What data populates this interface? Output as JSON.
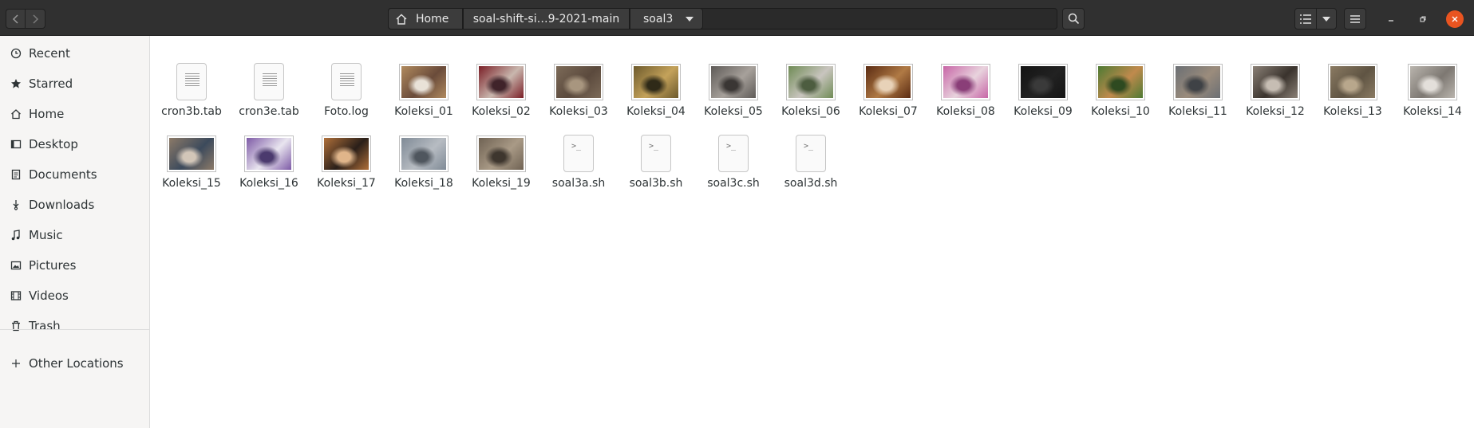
{
  "header": {
    "path": [
      "Home",
      "soal-shift-si…9-2021-main",
      "soal3"
    ]
  },
  "sidebar": {
    "items": [
      {
        "label": "Recent",
        "icon": "clock-icon"
      },
      {
        "label": "Starred",
        "icon": "star-icon"
      },
      {
        "label": "Home",
        "icon": "home-icon"
      },
      {
        "label": "Desktop",
        "icon": "desktop-icon"
      },
      {
        "label": "Documents",
        "icon": "document-icon"
      },
      {
        "label": "Downloads",
        "icon": "download-icon"
      },
      {
        "label": "Music",
        "icon": "music-icon"
      },
      {
        "label": "Pictures",
        "icon": "picture-icon"
      },
      {
        "label": "Videos",
        "icon": "video-icon"
      },
      {
        "label": "Trash",
        "icon": "trash-icon"
      }
    ],
    "other_locations": "Other Locations"
  },
  "files": [
    {
      "name": "cron3b.tab",
      "kind": "text"
    },
    {
      "name": "cron3e.tab",
      "kind": "text"
    },
    {
      "name": "Foto.log",
      "kind": "text"
    },
    {
      "name": "Koleksi_01",
      "kind": "image",
      "colors": [
        "#b08a5e",
        "#6a4b3a",
        "#e9e2d8"
      ]
    },
    {
      "name": "Koleksi_02",
      "kind": "image",
      "colors": [
        "#7a1e26",
        "#c9b7ae",
        "#40232a"
      ]
    },
    {
      "name": "Koleksi_03",
      "kind": "image",
      "colors": [
        "#7c6a58",
        "#5b4a3d",
        "#a8967f"
      ]
    },
    {
      "name": "Koleksi_04",
      "kind": "image",
      "colors": [
        "#6d5a2c",
        "#c4a25a",
        "#2f2a18"
      ]
    },
    {
      "name": "Koleksi_05",
      "kind": "image",
      "colors": [
        "#5e5a57",
        "#a7a19b",
        "#3a3634"
      ]
    },
    {
      "name": "Koleksi_06",
      "kind": "image",
      "colors": [
        "#6f8b55",
        "#c9c5bf",
        "#4d5d40"
      ]
    },
    {
      "name": "Koleksi_07",
      "kind": "image",
      "colors": [
        "#5a2b12",
        "#b07a45",
        "#e8d2b8"
      ]
    },
    {
      "name": "Koleksi_08",
      "kind": "image",
      "colors": [
        "#c765a6",
        "#e8d3dd",
        "#8a3e78"
      ]
    },
    {
      "name": "Koleksi_09",
      "kind": "image",
      "colors": [
        "#141414",
        "#222222",
        "#3a3a3a"
      ]
    },
    {
      "name": "Koleksi_10",
      "kind": "image",
      "colors": [
        "#4e7a33",
        "#c08a4d",
        "#2e4a20"
      ]
    },
    {
      "name": "Koleksi_11",
      "kind": "image",
      "colors": [
        "#6b6f74",
        "#9b8c7c",
        "#3f4246"
      ]
    },
    {
      "name": "Koleksi_12",
      "kind": "image",
      "colors": [
        "#8a8076",
        "#3a332d",
        "#c6bdb3"
      ]
    },
    {
      "name": "Koleksi_13",
      "kind": "image",
      "colors": [
        "#8a7a62",
        "#5f5443",
        "#b8a78c"
      ]
    },
    {
      "name": "Koleksi_14",
      "kind": "image",
      "colors": [
        "#b9b4ad",
        "#7d7872",
        "#e3dfda"
      ]
    },
    {
      "name": "Koleksi_15",
      "kind": "image",
      "colors": [
        "#8c7a68",
        "#3c4a5c",
        "#d2c6b8"
      ]
    },
    {
      "name": "Koleksi_16",
      "kind": "image",
      "colors": [
        "#7d5aa6",
        "#e9e5ef",
        "#4b3a6e"
      ]
    },
    {
      "name": "Koleksi_17",
      "kind": "image",
      "colors": [
        "#b0703a",
        "#2a1f19",
        "#e0b58a"
      ]
    },
    {
      "name": "Koleksi_18",
      "kind": "image",
      "colors": [
        "#7f8a96",
        "#b7bcc2",
        "#4f565e"
      ]
    },
    {
      "name": "Koleksi_19",
      "kind": "image",
      "colors": [
        "#6f6253",
        "#a99a86",
        "#3e362e"
      ]
    },
    {
      "name": "soal3a.sh",
      "kind": "script"
    },
    {
      "name": "soal3b.sh",
      "kind": "script"
    },
    {
      "name": "soal3c.sh",
      "kind": "script"
    },
    {
      "name": "soal3d.sh",
      "kind": "script"
    }
  ],
  "colors": {
    "header_bg": "#303030",
    "close_button": "#e95420"
  }
}
